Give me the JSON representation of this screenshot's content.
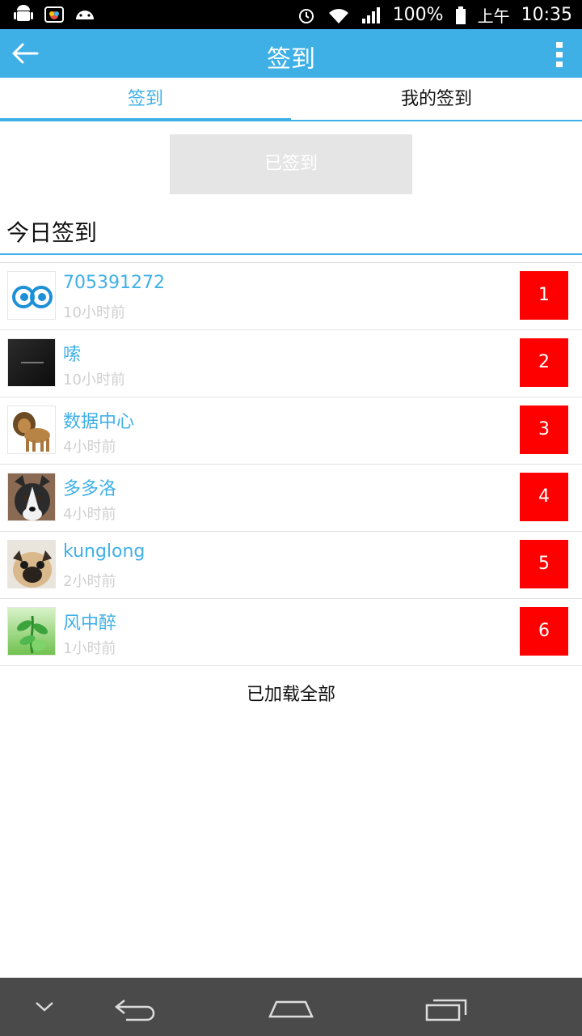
{
  "status_bar": {
    "battery": "100%",
    "ampm": "上午",
    "time": "10:35",
    "icons": [
      "android-icon",
      "gallery-icon",
      "android-face-icon",
      "alarm-icon",
      "wifi-icon",
      "signal-icon",
      "battery-icon"
    ]
  },
  "app_bar": {
    "title": "签到",
    "back_icon": "back-arrow-icon",
    "menu_icon": "overflow-menu-icon",
    "color": "#3fb0e6"
  },
  "tabs": [
    {
      "label": "签到",
      "active": true
    },
    {
      "label": "我的签到",
      "active": false
    }
  ],
  "sign_button": {
    "label": "已签到",
    "disabled": true
  },
  "section": {
    "title": "今日签到"
  },
  "checkins": [
    {
      "name": "705391272",
      "time": "10小时前",
      "rank": "1",
      "avatar": "eyes-logo"
    },
    {
      "name": "嗦",
      "time": "10小时前",
      "rank": "2",
      "avatar": "dark-photo"
    },
    {
      "name": "数据中心",
      "time": "4小时前",
      "rank": "3",
      "avatar": "lion"
    },
    {
      "name": "多多洛",
      "time": "4小时前",
      "rank": "4",
      "avatar": "husky"
    },
    {
      "name": "kunglong",
      "time": "2小时前",
      "rank": "5",
      "avatar": "pug"
    },
    {
      "name": "风中醉",
      "time": "1小时前",
      "rank": "6",
      "avatar": "green-plant"
    }
  ],
  "footer": {
    "loaded_text": "已加载全部"
  },
  "nav_bar": {
    "icons": [
      "hide-keyboard-icon",
      "back-icon",
      "home-icon",
      "recents-icon"
    ]
  },
  "colors": {
    "accent": "#3fb0e6",
    "rank_bg": "#ff0000",
    "disabled_btn": "#e5e5e5"
  }
}
